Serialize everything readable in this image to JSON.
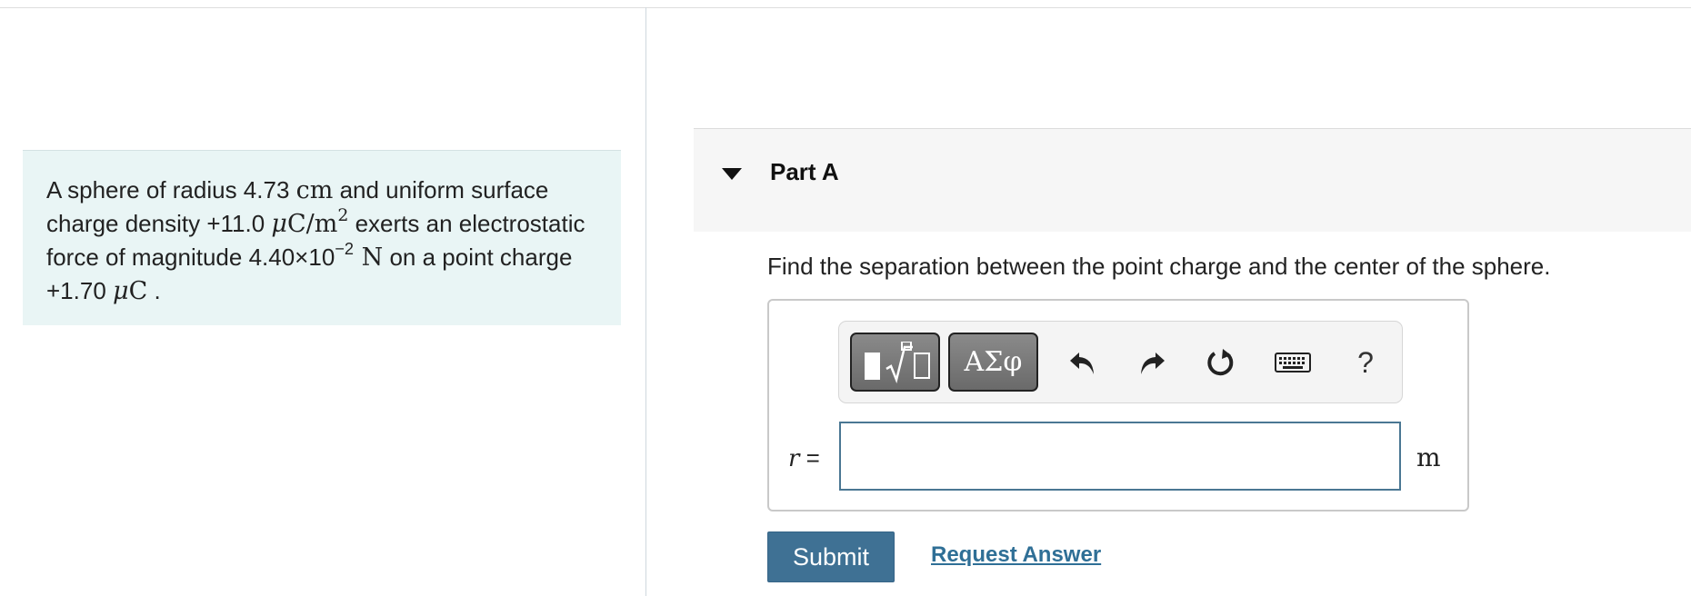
{
  "problem": {
    "t1": "A sphere of radius 4.73 ",
    "u_cm": "cm",
    "t2": " and uniform surface charge density +11.0 ",
    "u_mu1": "μ",
    "u_density": "C/m",
    "u_exp2": "2",
    "t3": " exerts an electrostatic force of magnitude 4.40×10",
    "exp_neg2": "−2",
    "u_N": " N",
    "t4": " on a point charge +1.70 ",
    "u_mu2": "μ",
    "u_C": "C",
    "t5": " ."
  },
  "part": {
    "title": "Part A",
    "question": "Find the separation between the point charge and the center of the sphere."
  },
  "toolbar": {
    "greek_label": "ΑΣφ",
    "help_label": "?"
  },
  "answer": {
    "variable": "r",
    "equals": " =",
    "value": "",
    "unit": "m"
  },
  "actions": {
    "submit_label": "Submit",
    "request_label": "Request Answer"
  },
  "colors": {
    "problem_bg": "#e9f5f5",
    "submit_bg": "#3f7194",
    "link": "#2f6f96",
    "input_border": "#4a7793"
  }
}
